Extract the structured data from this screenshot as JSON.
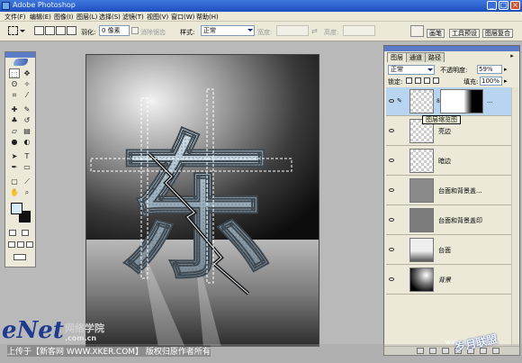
{
  "window": {
    "title": "Adobe Photoshop"
  },
  "menu": [
    "文件(F)",
    "编辑(E)",
    "图像(I)",
    "图层(L)",
    "选择(S)",
    "滤镜(T)",
    "视图(V)",
    "窗口(W)",
    "帮助(H)"
  ],
  "options": {
    "feather_label": "羽化:",
    "feather_value": "0 像素",
    "antialias_label": "消除锯齿",
    "style_label": "样式:",
    "style_value": "正常",
    "width_label": "宽度:",
    "height_label": "高度:"
  },
  "palette_well": {
    "tabs": [
      "画笔",
      "工具预设",
      "图层复合"
    ]
  },
  "layers_panel": {
    "tabs": [
      "图层",
      "通道",
      "路径"
    ],
    "blend_mode": "正常",
    "opacity_label": "不透明度:",
    "opacity_value": "59%",
    "lock_label": "锁定:",
    "fill_label": "填充:",
    "fill_value": "100%",
    "tooltip": "图层缩览图",
    "layers": [
      {
        "name": "",
        "has_mask": true,
        "mask_menu": "...",
        "active": true
      },
      {
        "name": "亮边",
        "active": false
      },
      {
        "name": "暗边",
        "active": false
      },
      {
        "name": "台面和背景盖...",
        "active": false
      },
      {
        "name": "台面和背景盖印",
        "active": false
      },
      {
        "name": "台面",
        "active": false
      },
      {
        "name": "背景",
        "active": false
      }
    ]
  },
  "canvas": {
    "glyph": "东"
  },
  "watermarks": {
    "enet_logo": "eNet",
    "enet_cn": "网络学院",
    "enet_url": ".com.cn",
    "footer": "上传于【新客网 WWW.XKER.COM】 版权归原作者所有",
    "site_cn": "岁月联盟",
    "site_url": "www.syue.com"
  },
  "colors": {
    "accent": "#2152c8",
    "panel_bg": "#ece9d8",
    "active_layer": "#b7d4f0",
    "foreground_swatch": "#d4ecfa",
    "background_swatch": "#111111"
  }
}
